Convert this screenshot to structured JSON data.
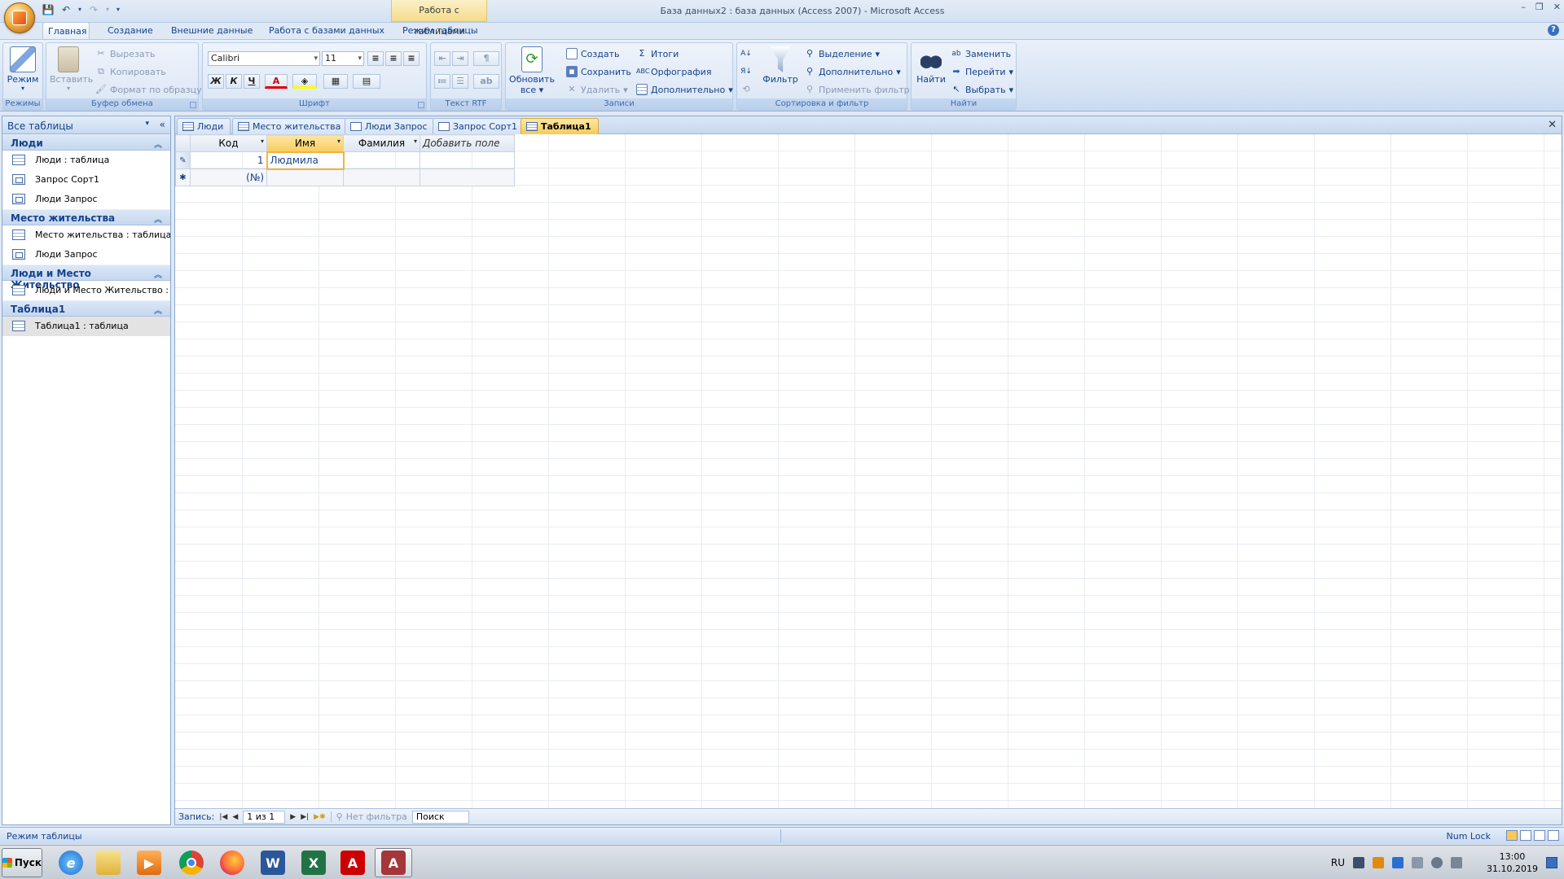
{
  "window": {
    "title": "База данных2 : база данных (Access 2007) - Microsoft Access",
    "context_tab_title": "Работа с таблицами"
  },
  "ribbon_tabs": [
    "Главная",
    "Создание",
    "Внешние данные",
    "Работа с базами данных",
    "Режим таблицы"
  ],
  "ribbon": {
    "views": {
      "label": "Режимы",
      "view_button": "Режим"
    },
    "clipboard": {
      "label": "Буфер обмена",
      "paste": "Вставить",
      "cut": "Вырезать",
      "copy": "Копировать",
      "format_painter": "Формат по образцу"
    },
    "font": {
      "label": "Шрифт",
      "font_name": "Calibri",
      "font_size": "11",
      "bold": "Ж",
      "italic": "К",
      "underline": "Ч",
      "font_color": "A"
    },
    "rich_text": {
      "label": "Текст RTF"
    },
    "records": {
      "label": "Записи",
      "refresh": "Обновить",
      "refresh2": "все",
      "new": "Создать",
      "save": "Сохранить",
      "delete": "Удалить",
      "totals": "Итоги",
      "spelling": "Орфография",
      "more": "Дополнительно"
    },
    "sort_filter": {
      "label": "Сортировка и фильтр",
      "filter": "Фильтр",
      "selection": "Выделение",
      "advanced": "Дополнительно",
      "toggle_filter": "Применить фильтр"
    },
    "find": {
      "label": "Найти",
      "find": "Найти",
      "replace": "Заменить",
      "goto": "Перейти",
      "select": "Выбрать"
    }
  },
  "nav_pane": {
    "header": "Все таблицы",
    "groups": [
      {
        "title": "Люди",
        "items": [
          {
            "label": "Люди : таблица",
            "icon": "table-icon"
          },
          {
            "label": "Запрос Сорт1",
            "icon": "query-icon"
          },
          {
            "label": "Люди Запрос",
            "icon": "query-icon"
          }
        ]
      },
      {
        "title": "Место жительства",
        "items": [
          {
            "label": "Место жительства : таблица",
            "icon": "table-icon"
          },
          {
            "label": "Люди Запрос",
            "icon": "query-icon"
          }
        ]
      },
      {
        "title": "Люди и Место Жительство",
        "items": [
          {
            "label": "Люди и Место Жительство : ...",
            "icon": "table-icon"
          }
        ]
      },
      {
        "title": "Таблица1",
        "items": [
          {
            "label": "Таблица1 : таблица",
            "icon": "table-icon",
            "selected": true
          }
        ]
      }
    ]
  },
  "doc_tabs": [
    {
      "label": "Люди",
      "icon": "table-icon"
    },
    {
      "label": "Место жительства",
      "icon": "table-icon"
    },
    {
      "label": "Люди Запрос",
      "icon": "query-icon"
    },
    {
      "label": "Запрос Сорт1",
      "icon": "query-icon"
    },
    {
      "label": "Таблица1",
      "icon": "table-icon",
      "active": true
    }
  ],
  "datasheet": {
    "columns": [
      "Код",
      "Имя",
      "Фамилия",
      "Добавить поле"
    ],
    "rows": [
      {
        "selector": "✎",
        "values": [
          "1",
          "Людмила",
          "",
          ""
        ]
      },
      {
        "selector": "✱",
        "values": [
          "(№)",
          "",
          "",
          ""
        ]
      }
    ]
  },
  "record_nav": {
    "label": "Запись:",
    "position": "1 из 1",
    "filter": "Нет фильтра",
    "search": "Поиск"
  },
  "status_bar": {
    "mode": "Режим таблицы",
    "numlock": "Num Lock"
  },
  "taskbar": {
    "start": "Пуск",
    "lang": "RU",
    "time": "13:00",
    "date": "31.10.2019"
  },
  "colors": {
    "accent": "#f7c957",
    "ribbon_text": "#15428b"
  }
}
